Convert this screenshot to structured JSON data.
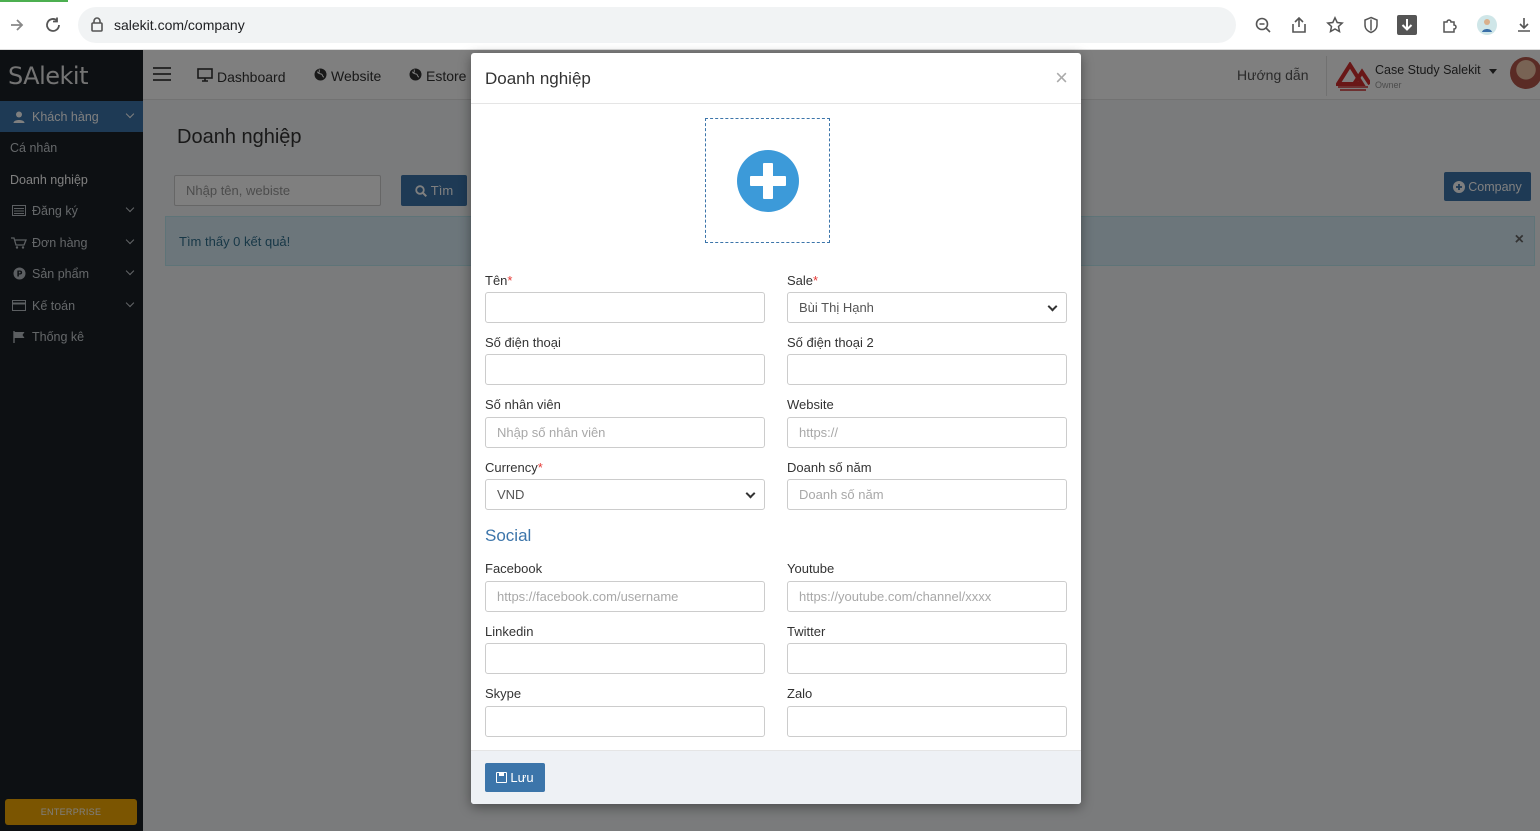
{
  "browser": {
    "url": "salekit.com/company"
  },
  "app": {
    "logo": "SAlekit"
  },
  "sidebar": {
    "items": [
      {
        "label": "Khách hàng",
        "icon": "user-icon",
        "active": true,
        "has_children": true
      },
      {
        "label": "Cá nhân",
        "sub": true
      },
      {
        "label": "Doanh nghiệp",
        "sub": true,
        "selected": true
      },
      {
        "label": "Đăng ký",
        "icon": "list-icon",
        "has_children": true
      },
      {
        "label": "Đơn hàng",
        "icon": "cart-icon",
        "has_children": true
      },
      {
        "label": "Sản phẩm",
        "icon": "product-icon",
        "has_children": true
      },
      {
        "label": "Kế toán",
        "icon": "card-icon",
        "has_children": true
      },
      {
        "label": "Thống kê",
        "icon": "flag-icon",
        "has_children": false
      }
    ],
    "enterprise_label": "ENTERPRISE"
  },
  "topbar": {
    "nav": [
      {
        "label": "Dashboard",
        "icon": "monitor-icon"
      },
      {
        "label": "Website",
        "icon": "globe-icon"
      },
      {
        "label": "Estore",
        "icon": "globe-icon"
      }
    ],
    "guide": "Hướng dẫn",
    "company_name": "Case Study Salekit",
    "company_role": "Owner"
  },
  "page": {
    "title": "Doanh nghiệp",
    "search_placeholder": "Nhập tên, webiste",
    "search_button": "Tìm",
    "add_button": "Company",
    "alert": "Tìm thấy 0 kết quả!",
    "alert_close": "×"
  },
  "modal": {
    "title": "Doanh nghiệp",
    "close": "×",
    "fields": {
      "name_label": "Tên",
      "sale_label": "Sale",
      "sale_value": "Bùi Thị Hạnh",
      "phone_label": "Số điện thoại",
      "phone2_label": "Số điện thoại 2",
      "employees_label": "Số nhân viên",
      "employees_placeholder": "Nhập số nhân viên",
      "website_label": "Website",
      "website_placeholder": "https://",
      "currency_label": "Currency",
      "currency_value": "VND",
      "revenue_label": "Doanh số năm",
      "revenue_placeholder": "Doanh số năm"
    },
    "social": {
      "title": "Social",
      "facebook_label": "Facebook",
      "facebook_placeholder": "https://facebook.com/username",
      "youtube_label": "Youtube",
      "youtube_placeholder": "https://youtube.com/channel/xxxx",
      "linkedin_label": "Linkedin",
      "twitter_label": "Twitter",
      "skype_label": "Skype",
      "zalo_label": "Zalo"
    },
    "save_button": "Lưu",
    "required_mark": "*"
  },
  "colors": {
    "primary": "#3c75aa",
    "sidebar": "#1a2026",
    "accent": "#f6ab02",
    "required": "#e53935"
  }
}
